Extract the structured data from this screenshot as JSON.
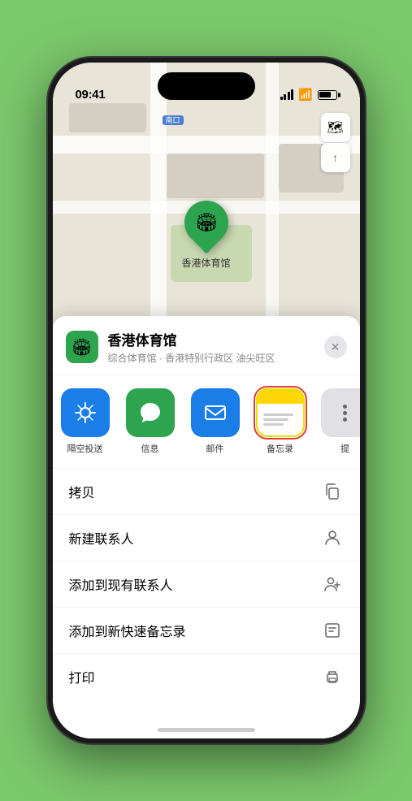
{
  "statusBar": {
    "time": "09:41",
    "location_arrow": "▶"
  },
  "map": {
    "south_gate_badge": "南口",
    "south_gate_label": "南口",
    "marker_label": "香港体育馆",
    "map_btn_map": "🗺",
    "map_btn_location": "⬆"
  },
  "bottomSheet": {
    "placeName": "香港体育馆",
    "placeSubtitle": "综合体育馆 · 香港特别行政区 油尖旺区",
    "closeBtn": "✕"
  },
  "actions": [
    {
      "id": "airdrop",
      "label": "隔空投送",
      "type": "airdrop"
    },
    {
      "id": "messages",
      "label": "信息",
      "type": "messages"
    },
    {
      "id": "mail",
      "label": "邮件",
      "type": "mail"
    },
    {
      "id": "notes",
      "label": "备忘录",
      "type": "notes",
      "selected": true
    },
    {
      "id": "more",
      "label": "提",
      "type": "more"
    }
  ],
  "menuItems": [
    {
      "id": "copy",
      "label": "拷贝",
      "icon": "copy"
    },
    {
      "id": "new-contact",
      "label": "新建联系人",
      "icon": "person"
    },
    {
      "id": "add-existing",
      "label": "添加到现有联系人",
      "icon": "person-add"
    },
    {
      "id": "add-notes",
      "label": "添加到新快速备忘录",
      "icon": "note"
    },
    {
      "id": "print",
      "label": "打印",
      "icon": "print"
    }
  ]
}
